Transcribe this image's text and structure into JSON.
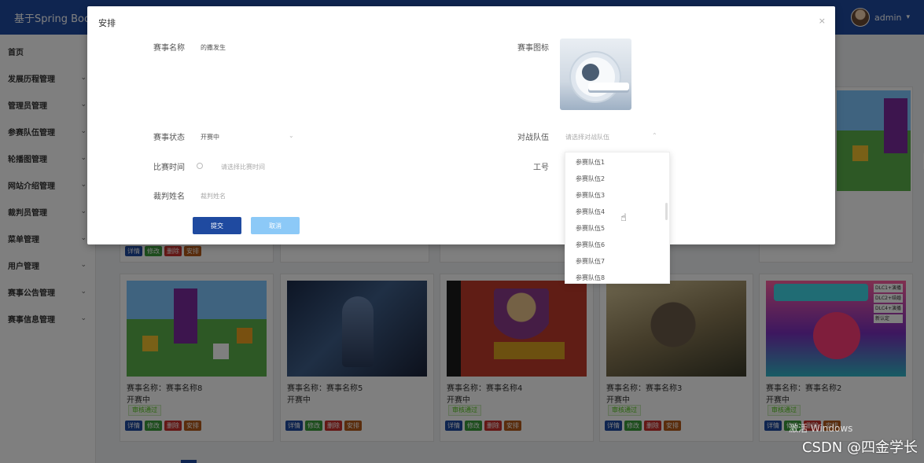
{
  "header": {
    "app_title": "基于Spring Boo",
    "username": "admin"
  },
  "sidebar": {
    "items": [
      {
        "label": "首页",
        "has_children": false
      },
      {
        "label": "发展历程管理",
        "has_children": true
      },
      {
        "label": "管理员管理",
        "has_children": true
      },
      {
        "label": "参赛队伍管理",
        "has_children": true
      },
      {
        "label": "轮播图管理",
        "has_children": true
      },
      {
        "label": "网站介绍管理",
        "has_children": true
      },
      {
        "label": "裁判员管理",
        "has_children": true
      },
      {
        "label": "菜单管理",
        "has_children": true
      },
      {
        "label": "用户管理",
        "has_children": true
      },
      {
        "label": "赛事公告管理",
        "has_children": true
      },
      {
        "label": "赛事信息管理",
        "has_children": true
      }
    ]
  },
  "cards": [
    {
      "name": "赛事名称：赛事名称8",
      "status": "开赛中",
      "badge": "审核通过",
      "art": "art-1"
    },
    {
      "name": "赛事名称：赛事名称5",
      "status": "开赛中",
      "badge": "",
      "art": "art-2"
    },
    {
      "name": "赛事名称：赛事名称4",
      "status": "开赛中",
      "badge": "审核通过",
      "art": "art-3"
    },
    {
      "name": "赛事名称：赛事名称3",
      "status": "开赛中",
      "badge": "审核通过",
      "art": "art-4"
    },
    {
      "name": "赛事名称：赛事名称2",
      "status": "开赛中",
      "badge": "审核通过",
      "art": "art-5"
    }
  ],
  "card_ops": {
    "detail": "详情",
    "edit": "修改",
    "delete": "删除",
    "arrange": "安排"
  },
  "art_5_boxes": [
    "DLC1+演播",
    "DLC2+结婚",
    "DLC4+演播",
    "新认定"
  ],
  "dialog": {
    "title": "安排",
    "close": "×",
    "fields": {
      "event_name_label": "赛事名称",
      "event_name_value": "的撒发生",
      "event_icon_label": "赛事图标",
      "event_status_label": "赛事状态",
      "event_status_value": "开赛中",
      "opponent_label": "对战队伍",
      "opponent_placeholder": "请选择对战队伍",
      "match_time_label": "比赛时间",
      "match_time_placeholder": "请选择比赛时间",
      "employee_id_label": "工号",
      "referee_name_label": "裁判姓名",
      "referee_name_placeholder": "裁判姓名"
    },
    "submit": "提交",
    "cancel": "取消"
  },
  "dropdown": {
    "options": [
      "参赛队伍1",
      "参赛队伍2",
      "参赛队伍3",
      "参赛队伍4",
      "参赛队伍5",
      "参赛队伍6",
      "参赛队伍7",
      "参赛队伍8"
    ]
  },
  "watermark": "CSDN @四金学长",
  "windows_watermark": "激活 Windows"
}
